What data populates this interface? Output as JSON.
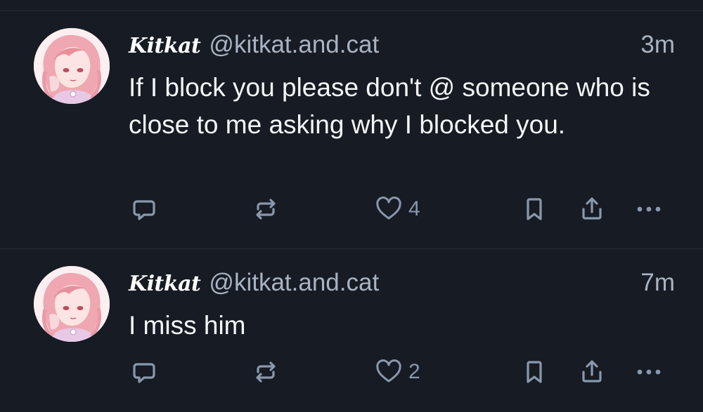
{
  "posts": [
    {
      "display_name": "Kitkat",
      "handle": "@kitkat.and.cat",
      "time": "3m",
      "text": "If I block you please don't @ someone who is close to me asking why I blocked you.",
      "like_count": "4",
      "avatar": "anime-girl-pink-hair-avatar"
    },
    {
      "display_name": "Kitkat",
      "handle": "@kitkat.and.cat",
      "time": "7m",
      "text": "I miss him",
      "like_count": "2",
      "avatar": "anime-girl-pink-hair-avatar"
    }
  ],
  "icons": {
    "reply": "reply-bubble-icon",
    "repost": "repost-arrows-icon",
    "like": "heart-icon",
    "bookmark": "bookmark-icon",
    "share": "share-upload-icon",
    "more": "more-dots-icon"
  },
  "colors": {
    "background": "#161b24",
    "divider": "#262c37",
    "text_primary": "#f4f6f8",
    "text_secondary": "#a9b3c1",
    "icon": "#8a98ab"
  }
}
